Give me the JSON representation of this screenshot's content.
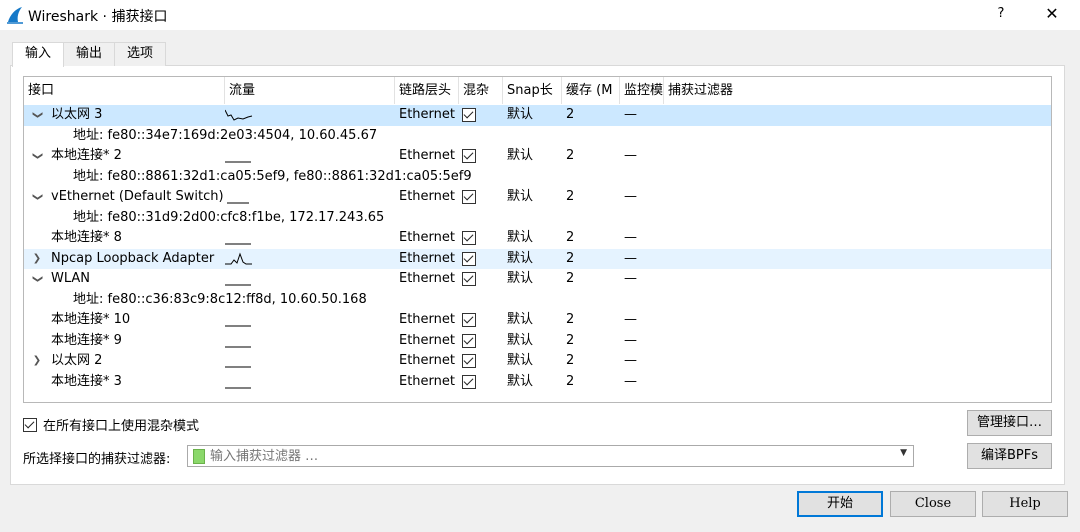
{
  "window": {
    "title": "Wireshark · 捕获接口",
    "help": "?",
    "close": "✕"
  },
  "tabs": [
    {
      "label": "输入"
    },
    {
      "label": "输出"
    },
    {
      "label": "选项"
    }
  ],
  "columns": {
    "interface": "接口",
    "traffic": "流量",
    "link": "链路层头",
    "promisc": "混杂",
    "snap": "Snap长",
    "buffer": "缓存 (M",
    "monitor": "监控模",
    "filter": "捕获过滤器"
  },
  "rows": [
    {
      "chevron": "v",
      "name": "以太网 3",
      "link": "Ethernet",
      "snap": "默认",
      "buffer": "2",
      "monitor": "—"
    },
    {
      "detail": "地址: fe80::34e7:169d:2e03:4504, 10.60.45.67"
    },
    {
      "chevron": "v",
      "name": "本地连接* 2",
      "link": "Ethernet",
      "snap": "默认",
      "buffer": "2",
      "monitor": "—"
    },
    {
      "detail": "地址: fe80::8861:32d1:ca05:5ef9, fe80::8861:32d1:ca05:5ef9"
    },
    {
      "chevron": "v",
      "name": "vEthernet (Default Switch)",
      "link": "Ethernet",
      "snap": "默认",
      "buffer": "2",
      "monitor": "—"
    },
    {
      "detail": "地址: fe80::31d9:2d00:cfc8:f1be, 172.17.243.65"
    },
    {
      "chevron": "",
      "name": "本地连接* 8",
      "link": "Ethernet",
      "snap": "默认",
      "buffer": "2",
      "monitor": "—"
    },
    {
      "chevron": ">",
      "name": "Npcap Loopback Adapter",
      "link": "Ethernet",
      "snap": "默认",
      "buffer": "2",
      "monitor": "—"
    },
    {
      "chevron": "v",
      "name": "WLAN",
      "link": "Ethernet",
      "snap": "默认",
      "buffer": "2",
      "monitor": "—"
    },
    {
      "detail": "地址: fe80::c36:83c9:8c12:ff8d, 10.60.50.168"
    },
    {
      "chevron": "",
      "name": "本地连接* 10",
      "link": "Ethernet",
      "snap": "默认",
      "buffer": "2",
      "monitor": "—"
    },
    {
      "chevron": "",
      "name": "本地连接* 9",
      "link": "Ethernet",
      "snap": "默认",
      "buffer": "2",
      "monitor": "—"
    },
    {
      "chevron": ">",
      "name": "以太网 2",
      "link": "Ethernet",
      "snap": "默认",
      "buffer": "2",
      "monitor": "—"
    },
    {
      "chevron": "",
      "name": "本地连接* 3",
      "link": "Ethernet",
      "snap": "默认",
      "buffer": "2",
      "monitor": "—"
    }
  ],
  "promisc_all": {
    "label": "在所有接口上使用混杂模式"
  },
  "filter": {
    "label": "所选择接口的捕获过滤器:",
    "placeholder": "输入捕获过滤器 …"
  },
  "buttons": {
    "manage": "管理接口…",
    "compile": "编译BPFs",
    "start": "开始",
    "close": "Close",
    "help": "Help"
  }
}
